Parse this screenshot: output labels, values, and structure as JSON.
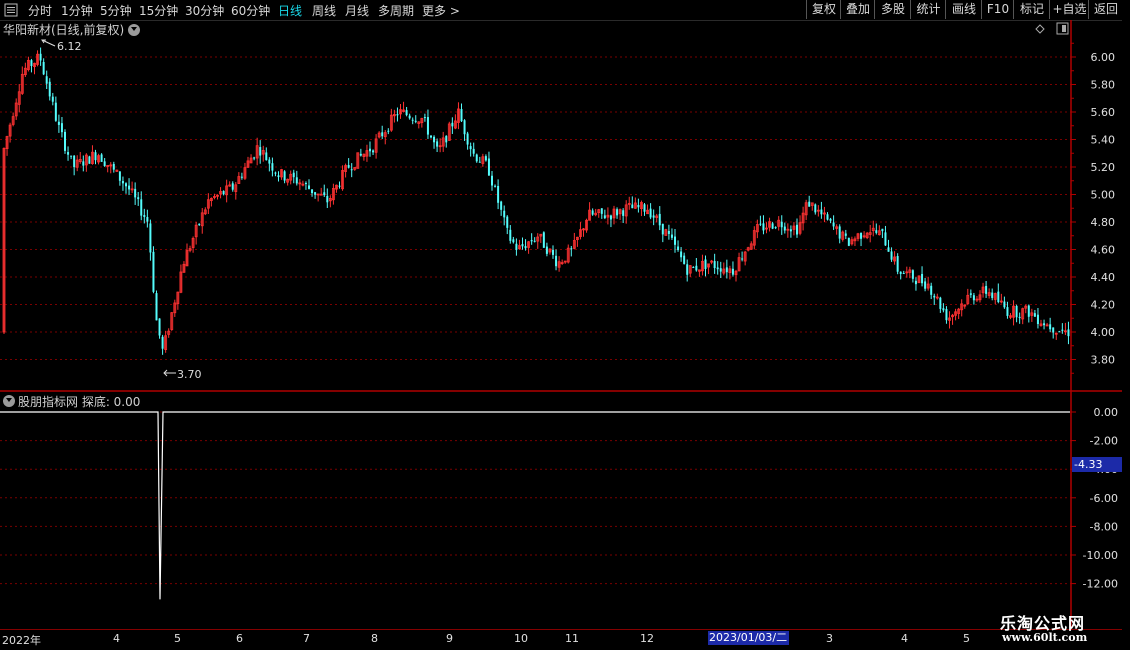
{
  "toolbar": {
    "tabs": [
      {
        "label": "分时"
      },
      {
        "label": "1分钟"
      },
      {
        "label": "5分钟"
      },
      {
        "label": "15分钟"
      },
      {
        "label": "30分钟"
      },
      {
        "label": "60分钟"
      },
      {
        "label": "日线"
      },
      {
        "label": "周线"
      },
      {
        "label": "月线"
      },
      {
        "label": "多周期"
      },
      {
        "label": "更多 >"
      }
    ],
    "active_tab": "日线",
    "right_buttons": [
      {
        "label": "复权"
      },
      {
        "label": "叠加"
      },
      {
        "label": "多股"
      },
      {
        "label": "统计"
      },
      {
        "label": "画线"
      },
      {
        "label": "F10"
      },
      {
        "label": "标记"
      },
      {
        "label": "+自选"
      },
      {
        "label": "返回"
      }
    ]
  },
  "stock": {
    "title": "华阳新材(日线,前复权)"
  },
  "price_axis": [
    "6.00",
    "5.80",
    "5.60",
    "5.40",
    "5.20",
    "5.00",
    "4.80",
    "4.60",
    "4.40",
    "4.20",
    "4.00",
    "3.80"
  ],
  "annotations": {
    "high": "6.12",
    "low": "3.70"
  },
  "indicator": {
    "title": "股朋指标网  探底: 0.00",
    "axis": [
      "0.00",
      "-2.00",
      "-4.00",
      "-6.00",
      "-8.00",
      "-10.00",
      "-12.00"
    ],
    "current_badge": "-4.33"
  },
  "x_axis": {
    "labels": [
      "2022年",
      "4",
      "5",
      "6",
      "7",
      "8",
      "9",
      "10",
      "11",
      "12",
      "3",
      "4",
      "5"
    ],
    "highlight": "2023/01/03/二"
  },
  "watermark": {
    "line1": "乐淘公式网",
    "line2": "www.60lt.com"
  },
  "colors": {
    "up": "#ff3232",
    "down": "#54fcfc",
    "grid": "#7a0000",
    "border": "#b00000",
    "active": "#19d8e8",
    "badge": "#1c2aa8"
  }
}
